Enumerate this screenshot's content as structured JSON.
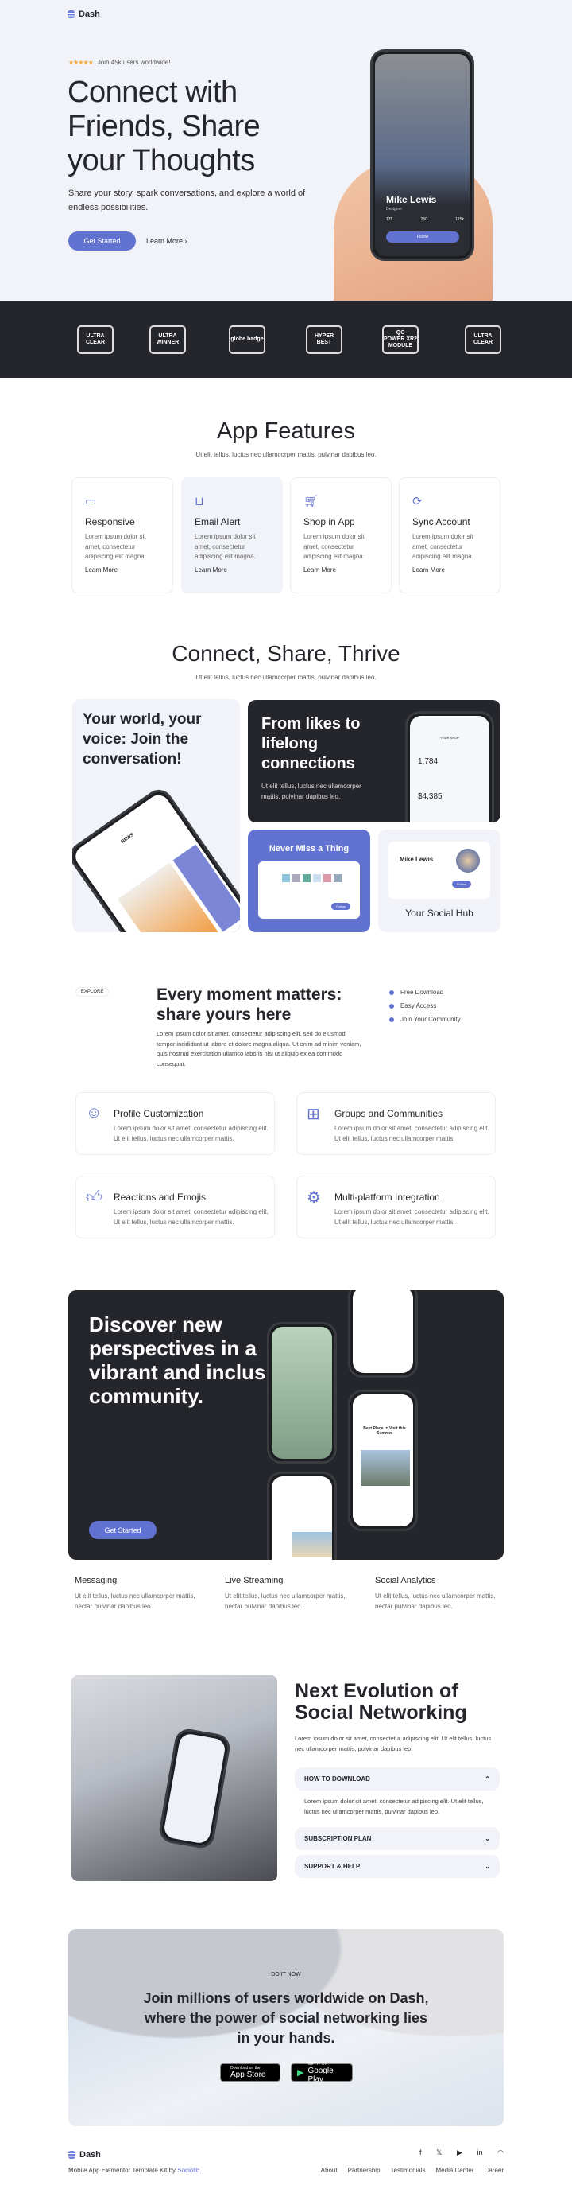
{
  "brand": {
    "name": "Dash",
    "accent": "#6272d0",
    "dark": "#25262b"
  },
  "hero": {
    "rating_icon": "five-stars",
    "rating_text": "Join 45k users worldwide!",
    "title_lines": [
      "Connect with",
      "Friends, Share",
      "your Thoughts"
    ],
    "subtitle": "Share your story, spark conversations, and explore a world of endless possibilities.",
    "primary_button": "Get Started",
    "secondary_button": "Learn More",
    "phone": {
      "name": "Mike Lewis",
      "role": "Designer",
      "stats": [
        "175",
        "250",
        "125k"
      ],
      "follow": "Follow"
    }
  },
  "awards": [
    {
      "lines": [
        "ULTRA",
        "CLEAR"
      ]
    },
    {
      "lines": [
        "ULTRA",
        "WINNER"
      ]
    },
    {
      "lines": [
        "globe badge"
      ]
    },
    {
      "lines": [
        "HYPER",
        "BEST"
      ]
    },
    {
      "lines": [
        "QC",
        "POWER XR2 MODULE"
      ]
    },
    {
      "lines": [
        "ULTRA",
        "CLEAR"
      ]
    }
  ],
  "features": {
    "title": "App Features",
    "subtitle": "Ut elit tellus, luctus nec ullamcorper mattis, pulvinar dapibus leo.",
    "cards": [
      {
        "icon": "devices-icon",
        "title": "Responsive",
        "text": "Lorem ipsum dolor sit amet, consectetur adipiscing elit magna.",
        "link": "Learn More"
      },
      {
        "icon": "inbox-icon",
        "title": "Email Alert",
        "text": "Lorem ipsum dolor sit amet, consectetur adipiscing elit magna.",
        "link": "Learn More"
      },
      {
        "icon": "cart-icon",
        "title": "Shop in App",
        "text": "Lorem ipsum dolor sit amet, consectetur adipiscing elit magna.",
        "link": "Learn More"
      },
      {
        "icon": "sync-icon",
        "title": "Sync Account",
        "text": "Lorem ipsum dolor sit amet, consectetur adipiscing elit magna.",
        "link": "Learn More"
      }
    ]
  },
  "bento": {
    "title": "Connect, Share, Thrive",
    "subtitle": "Ut elit tellus, luctus nec ullamcorper mattis, pulvinar dapibus leo.",
    "card1": {
      "title": "Your world, your voice: Join the conversation!",
      "screen_title": "NEWS"
    },
    "card2": {
      "title": "From likes to lifelong connections",
      "text": "Ut elit tellus, luctus nec ullamcorper mattis, pulvinar dapibus leo.",
      "screen_title": "YOUR SHOP",
      "stat1": "1,784",
      "stat2": "$4,385"
    },
    "card3": {
      "title": "Never Miss a Thing",
      "follow": "Follow"
    },
    "card4": {
      "title": "Your Social Hub",
      "name": "Mike Lewis",
      "follow": "Follow"
    }
  },
  "explore": {
    "badge": "EXPLORE",
    "title": "Every moment matters: share yours here",
    "text": "Lorem ipsum dolor sit amet, consectetur adipiscing elit, sed do eiusmod tempor incididunt ut labore et dolore magna aliqua. Ut enim ad minim veniam, quis nostrud exercitation ullamco laboris nisi ut aliquip ex ea commodo consequat.",
    "checklist": [
      "Free Download",
      "Easy Access",
      "Join Your Community"
    ],
    "cards": [
      {
        "icon": "smiley-icon",
        "title": "Profile Customization",
        "text": "Lorem ipsum dolor sit amet, consectetur adipiscing elit. Ut elit tellus, luctus nec ullamcorper mattis."
      },
      {
        "icon": "gift-icon",
        "title": "Groups and Communities",
        "text": "Lorem ipsum dolor sit amet, consectetur adipiscing elit. Ut elit tellus, luctus nec ullamcorper mattis."
      },
      {
        "icon": "thumbs-up-icon",
        "title": "Reactions and Emojis",
        "text": "Lorem ipsum dolor sit amet, consectetur adipiscing elit. Ut elit tellus, luctus nec ullamcorper mattis."
      },
      {
        "icon": "gear-icon",
        "title": "Multi-platform Integration",
        "text": "Lorem ipsum dolor sit amet, consectetur adipiscing elit. Ut elit tellus, luctus nec ullamcorper mattis."
      }
    ]
  },
  "discover": {
    "title": "Discover new perspectives in a vibrant and inclusive community.",
    "button": "Get Started",
    "screen_text": "Best Place to Visit this Summer",
    "columns": [
      {
        "title": "Messaging",
        "text": "Ut elit tellus, luctus nec ullamcorper mattis, nectar pulvinar dapibus leo."
      },
      {
        "title": "Live Streaming",
        "text": "Ut elit tellus, luctus nec ullamcorper mattis, nectar pulvinar dapibus leo."
      },
      {
        "title": "Social Analytics",
        "text": "Ut elit tellus, luctus nec ullamcorper mattis, nectar pulvinar dapibus leo."
      }
    ]
  },
  "evolution": {
    "title": "Next Evolution of Social Networking",
    "text": "Lorem ipsum dolor sit amet, consectetur adipiscing elit. Ut elit tellus, luctus nec ullamcorper mattis, pulvinar dapibus leo.",
    "accordion": [
      {
        "label": "HOW TO DOWNLOAD",
        "open": true,
        "content": "Lorem ipsum dolor sit amet, consectetur adipiscing elit. Ut elit tellus, luctus nec ullamcorper mattis, pulvinar dapibus leo."
      },
      {
        "label": "SUBSCRIPTION PLAN",
        "open": false
      },
      {
        "label": "SUPPORT & HELP",
        "open": false
      }
    ]
  },
  "cta": {
    "eyebrow": "DO IT NOW",
    "title": "Join millions of users worldwide on Dash, where the power of social networking lies in your hands.",
    "app_store": {
      "small": "Download on the",
      "big": "App Store"
    },
    "google_play": {
      "small": "GET IT ON",
      "big": "Google Play"
    }
  },
  "footer": {
    "name": "Dash",
    "credit_prefix": "Mobile App Elementor Template Kit by ",
    "credit_link": "Sociolib",
    "credit_suffix": ".",
    "socials": [
      "facebook-icon",
      "twitter-icon",
      "youtube-icon",
      "linkedin-icon",
      "rss-icon"
    ],
    "links": [
      "About",
      "Partnership",
      "Testimonials",
      "Media Center",
      "Career"
    ]
  }
}
